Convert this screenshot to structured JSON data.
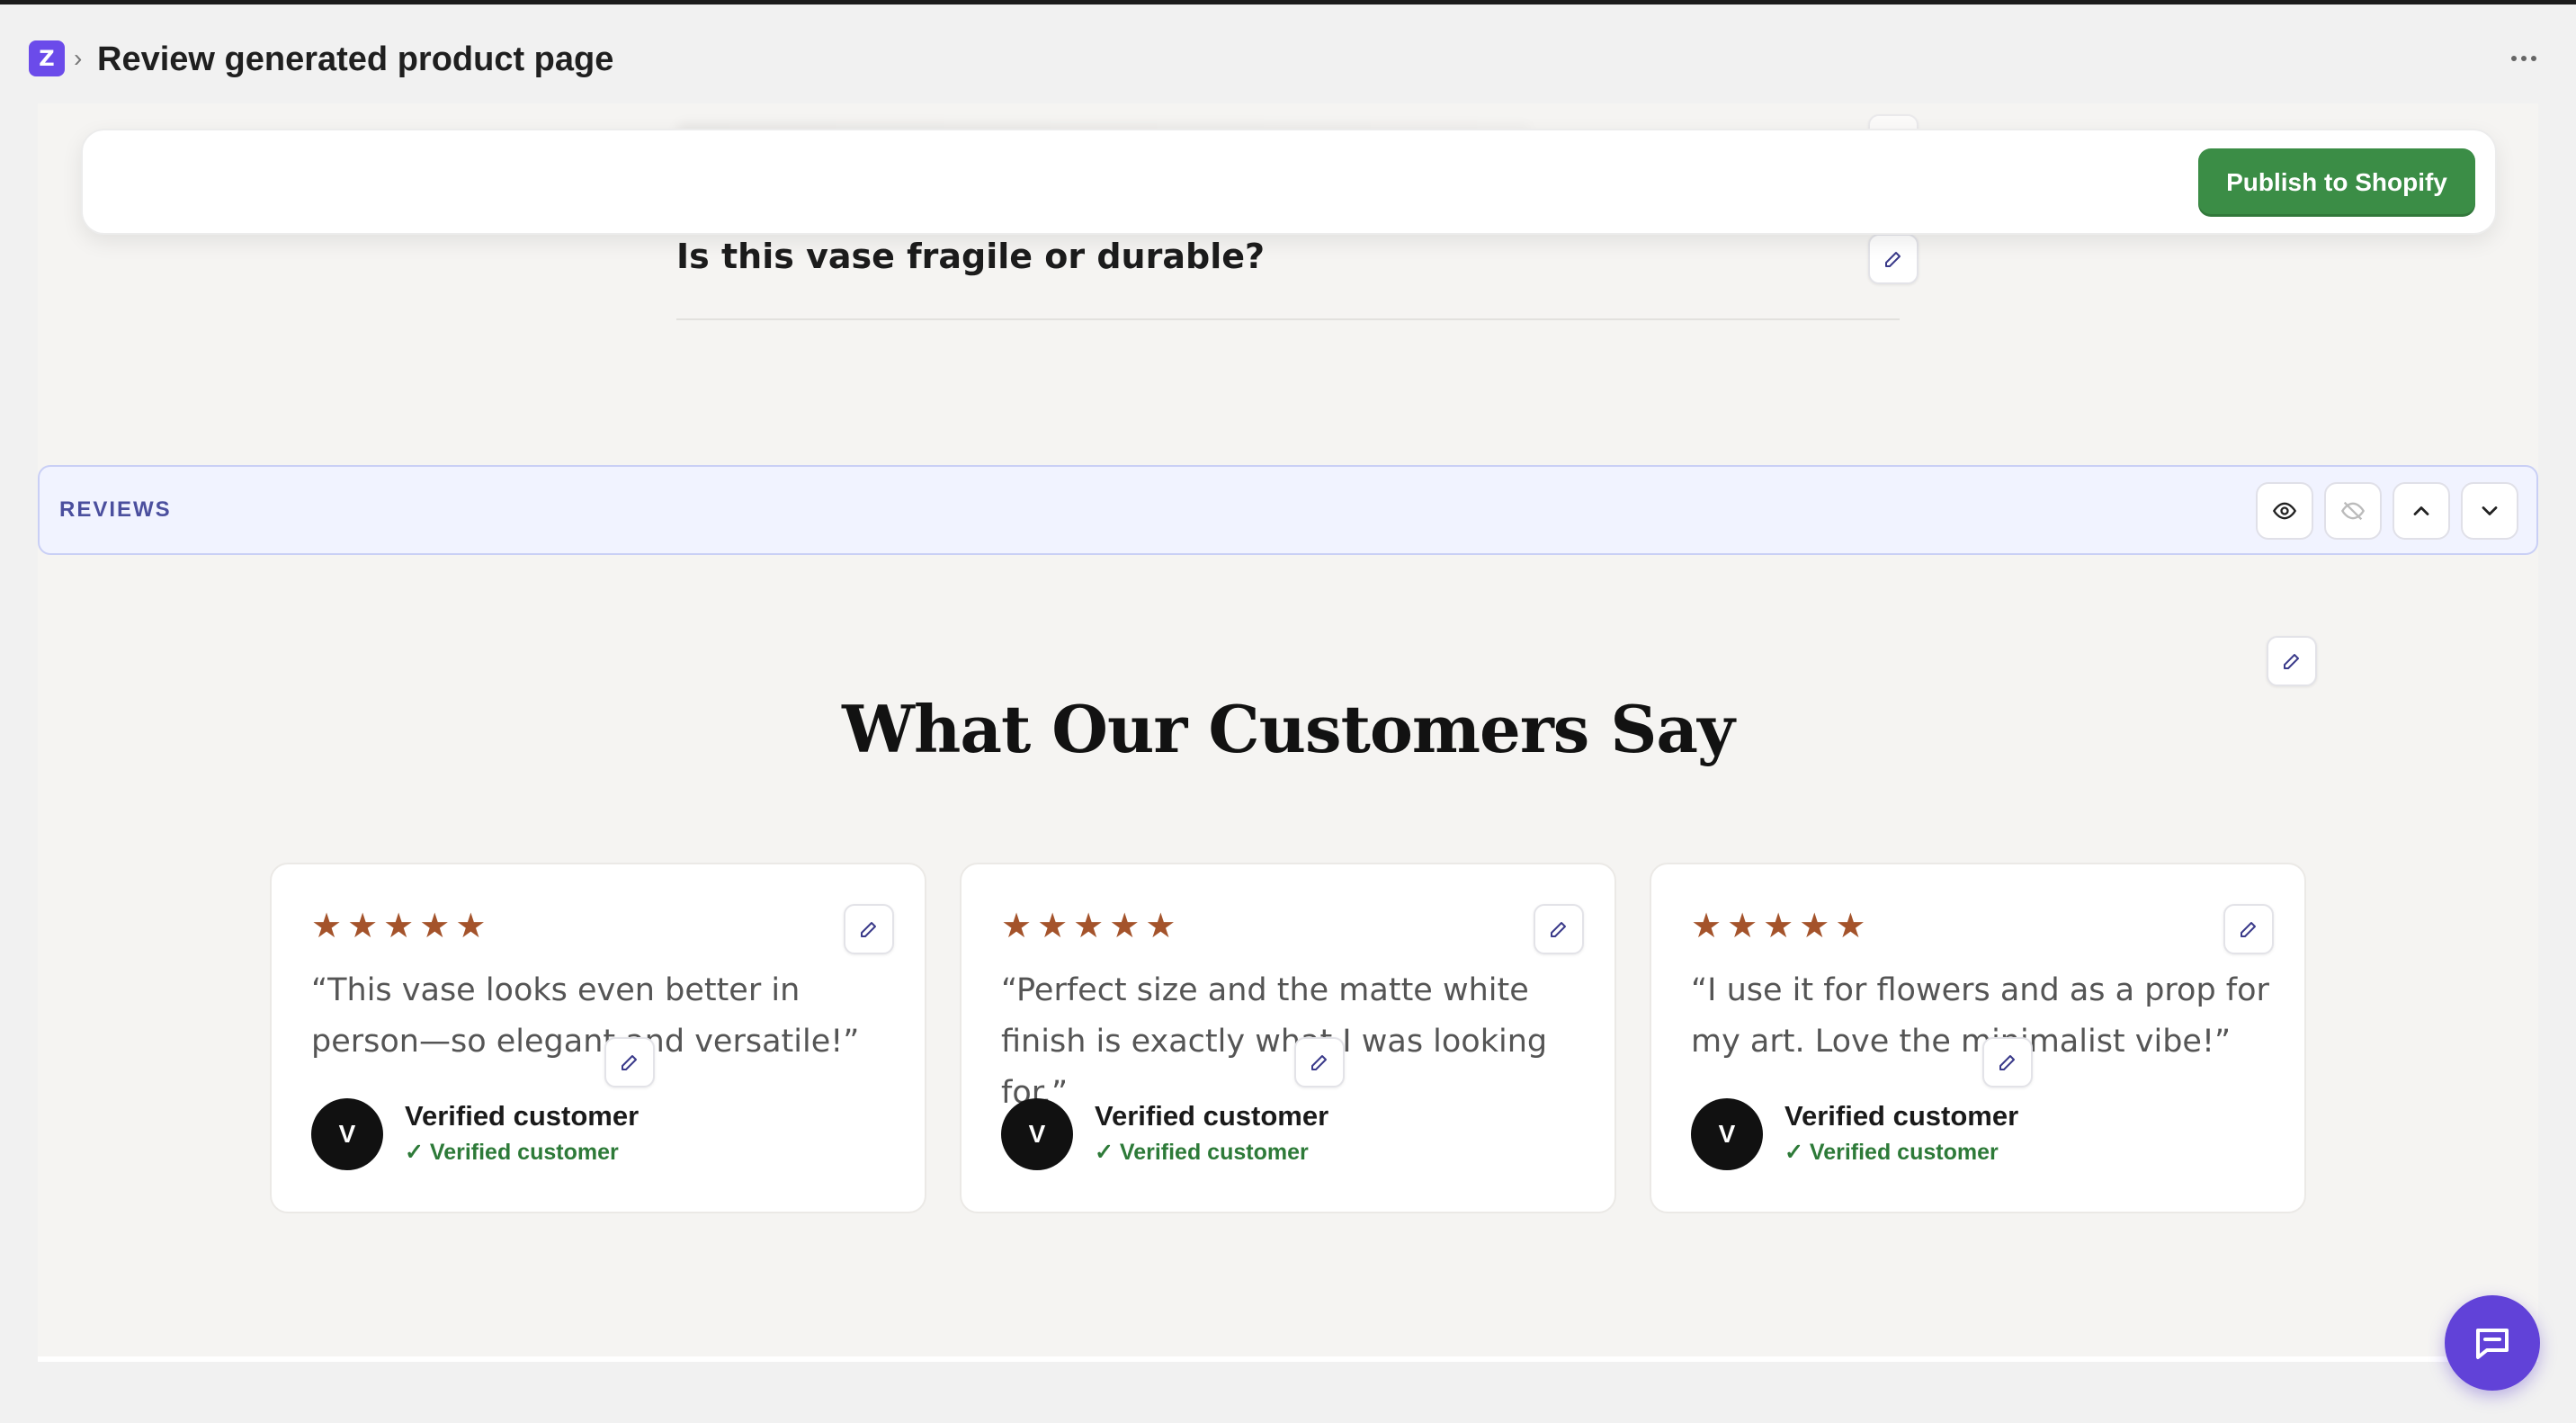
{
  "header": {
    "logo_letter": "Z",
    "separator": "›",
    "title": "Review generated product page"
  },
  "publish_bar": {
    "publish_label": "Publish to Shopify",
    "button_color": "#3b8d46"
  },
  "faq": {
    "question": "Is this vase fragile or durable?"
  },
  "section": {
    "label": "REVIEWS",
    "controls": [
      "eye-icon",
      "eye-off-icon",
      "chevron-up-icon",
      "chevron-down-icon"
    ]
  },
  "reviews": {
    "heading": "What Our Customers Say",
    "star_color": "#a4532b",
    "cards": [
      {
        "quote": "“This vase looks even better in person—so elegant and versatile!”",
        "avatar": "V",
        "name": "Verified customer",
        "badge": "✓ Verified customer",
        "rating": 5
      },
      {
        "quote": "“Perfect size and the matte white finish is exactly what I was looking for.”",
        "avatar": "V",
        "name": "Verified customer",
        "badge": "✓ Verified customer",
        "rating": 5
      },
      {
        "quote": "“I use it for flowers and as a prop for my art. Love the minimalist vibe!”",
        "avatar": "V",
        "name": "Verified customer",
        "badge": "✓ Verified customer",
        "rating": 5
      }
    ]
  },
  "chat": {
    "icon": "chat-icon"
  },
  "accent_color": "#6142d8"
}
